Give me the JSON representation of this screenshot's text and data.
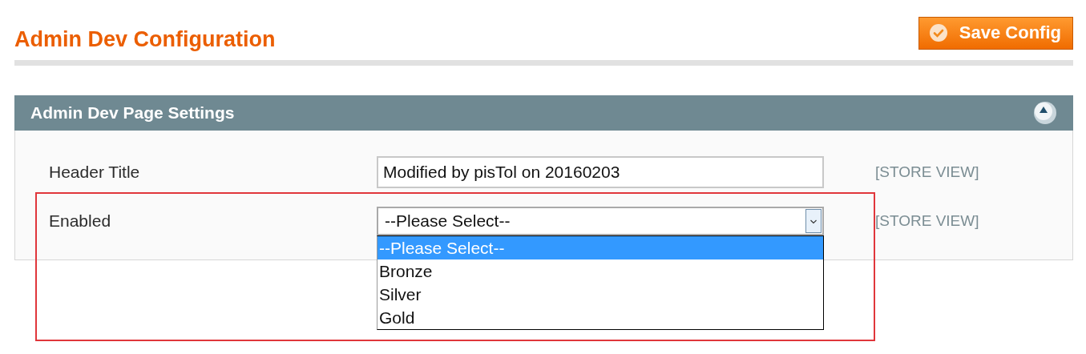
{
  "page_title": "Admin Dev Configuration",
  "save_button": {
    "label": "Save Config"
  },
  "section": {
    "title": "Admin Dev Page Settings",
    "expanded": true,
    "fields": [
      {
        "kind": "text",
        "label": "Header Title",
        "value": "Modified by pisTol on 20160203",
        "scope": "[STORE VIEW]"
      },
      {
        "kind": "select",
        "label": "Enabled",
        "value": "--Please Select--",
        "scope": "[STORE VIEW]",
        "open": true,
        "options": [
          {
            "label": "--Please Select--",
            "selected": true
          },
          {
            "label": "Bronze",
            "selected": false
          },
          {
            "label": "Silver",
            "selected": false
          },
          {
            "label": "Gold",
            "selected": false
          }
        ]
      }
    ]
  },
  "annotation": {
    "kind": "highlight",
    "color": "#e0363b"
  }
}
